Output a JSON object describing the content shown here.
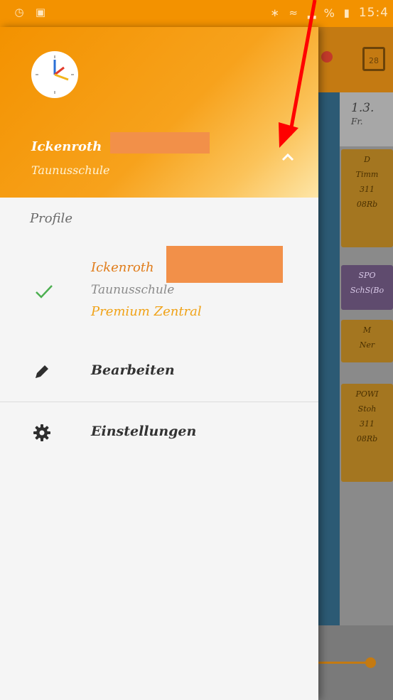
{
  "status_bar": {
    "time": "15:4",
    "battery": "%",
    "left_icons": [
      "alarm-icon",
      "app-icon"
    ],
    "right_icons": [
      "bluetooth-icon",
      "wifi-icon",
      "signal-icon",
      "battery-icon"
    ]
  },
  "background": {
    "date": "1.3.",
    "weekday": "Fr.",
    "lessons": [
      {
        "lines": [
          "D",
          "Timm",
          "311",
          "08Rb"
        ]
      },
      {
        "lines": [
          "SPO",
          "SchS(Bo"
        ]
      },
      {
        "lines": [
          "M",
          "Ner"
        ]
      },
      {
        "lines": [
          "POWI",
          "Stoh",
          "311",
          "08Rb"
        ]
      }
    ],
    "calendar_icon_text": "28"
  },
  "drawer": {
    "header": {
      "name": "Ickenroth",
      "school": "Taunusschule"
    },
    "section_label": "Profile",
    "profile": {
      "name": "Ickenroth",
      "school": "Taunusschule",
      "tier": "Premium Zentral"
    },
    "menu": {
      "edit_label": "Bearbeiten",
      "settings_label": "Einstellungen"
    }
  },
  "colors": {
    "accent": "#f39200",
    "redaction": "#f29049",
    "check": "#4caf50",
    "annotation_arrow": "#ff0000"
  }
}
